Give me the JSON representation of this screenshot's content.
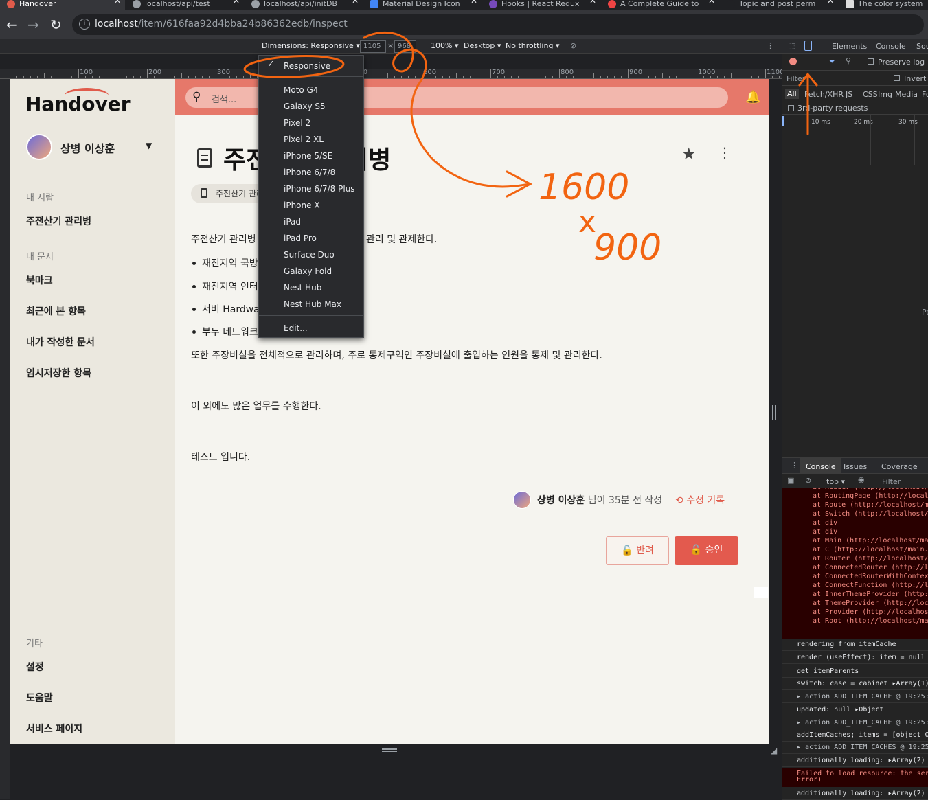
{
  "browser": {
    "tabs": [
      {
        "label": "Handover",
        "active": true
      },
      {
        "label": "localhost/api/test"
      },
      {
        "label": "localhost/api/initDB"
      },
      {
        "label": "Material Design Icon"
      },
      {
        "label": "Hooks | React Redux"
      },
      {
        "label": "A Complete Guide to"
      },
      {
        "label": "Topic and post perm"
      },
      {
        "label": "The color system"
      }
    ],
    "url_host": "localhost",
    "url_path": "/item/616faa92d4bba24b86362edb/inspect"
  },
  "device_toolbar": {
    "dimensions_label": "Dimensions: Responsive",
    "width": "1105",
    "times": "×",
    "height": "968",
    "zoom": "100%",
    "device_type": "Desktop",
    "throttling": "No throttling"
  },
  "ruler": {
    "labels": [
      "100",
      "200",
      "300",
      "400",
      "500",
      "600",
      "700",
      "800",
      "900",
      "1000",
      "1100"
    ]
  },
  "device_menu": {
    "selected": "Responsive",
    "items": [
      "Moto G4",
      "Galaxy S5",
      "Pixel 2",
      "Pixel 2 XL",
      "iPhone 5/SE",
      "iPhone 6/7/8",
      "iPhone 6/7/8 Plus",
      "iPhone X",
      "iPad",
      "iPad Pro",
      "Surface Duo",
      "Galaxy Fold",
      "Nest Hub",
      "Nest Hub Max"
    ],
    "edit": "Edit..."
  },
  "app": {
    "logo": "Handover",
    "user_name": "상병 이상훈",
    "sidebar": {
      "sections": [
        {
          "heading": "내 서랍",
          "items": [
            "주전산기 관리병"
          ]
        },
        {
          "heading": "내 문서",
          "items": [
            "북마크",
            "최근에 본 항목",
            "내가 작성한 문서",
            "임시저장한 항목"
          ]
        },
        {
          "heading": "기타",
          "items": [
            "설정",
            "도움말",
            "서비스 페이지"
          ]
        }
      ]
    },
    "search_placeholder": "검색...",
    "doc": {
      "title_left": "주전",
      "title_right": "리병",
      "chip": "주전산기 관리",
      "intro_left": "주전산기 관리병",
      "intro_right": "관리 및 관제한다.",
      "bullets": [
        "재진지역 국방",
        "재진지역 인터",
        "서버 Hardwar",
        "부두 네트워크"
      ],
      "para2": "또한 주장비실을 전체적으로 관리하며, 주로 통제구역인 주장비실에 출입하는 인원을 통제 및 관리한다.",
      "para3": "이 외에도 많은 업무를 수행한다.",
      "para4": "테스트 입니다.",
      "author": "상병 이상훈",
      "author_suffix": " 님이 35분 전 작성",
      "history": "수정 기록",
      "reject": "반려",
      "approve": "승인"
    }
  },
  "devtools": {
    "tabs": [
      "Elements",
      "Console",
      "Sou"
    ],
    "preserve_log": "Preserve log",
    "filter": "Filter",
    "invert": "Invert",
    "types": [
      "All",
      "Fetch/XHR",
      "JS",
      "CSS",
      "Img",
      "Media",
      "Fo"
    ],
    "third_party": "3rd-party requests",
    "timeline": [
      "10 ms",
      "20 ms",
      "30 ms"
    ],
    "side_letter": "Pe",
    "drawer_tabs": [
      "Console",
      "Issues",
      "Coverage"
    ],
    "context": "top",
    "console_filter": "Filter",
    "stack": [
      "at Header (http://localhost/",
      "at RoutingPage (http://local",
      "at Route (http://localhost/ma",
      "at Switch (http://localhost/",
      "at div",
      "at div",
      "at Main (http://localhost/ma",
      "at C (http://localhost/main.",
      "at Router (http://localhost/",
      "at ConnectedRouter (http://l",
      "at ConnectedRouterWithContex",
      "at ConnectFunction (http://l",
      "at InnerThemeProvider (http:",
      "at ThemeProvider (http://loc",
      "at Provider (http://localhost",
      "at Root (http://localhost/ma"
    ],
    "logs": [
      "rendering from itemCache",
      "render (useEffect): item = null",
      "get itemParents",
      "switch: case = cabinet ▸Array(1)",
      "▸ action ADD_ITEM_CACHE @ 19:25:1",
      "updated: null ▸Object",
      "▸ action ADD_ITEM_CACHE @ 19:25:1",
      "addItemCaches; items = [object O",
      "▸ action ADD_ITEM_CACHES @ 19:25:",
      "additionally loading: ▸Array(2)",
      "Failed to load resource: the ser",
      "Error)",
      "additionally loading: ▸Array(2)"
    ]
  },
  "annotation": {
    "text_top": "1600",
    "text_mid": "x",
    "text_bottom": "900",
    "color": "#f26411"
  }
}
